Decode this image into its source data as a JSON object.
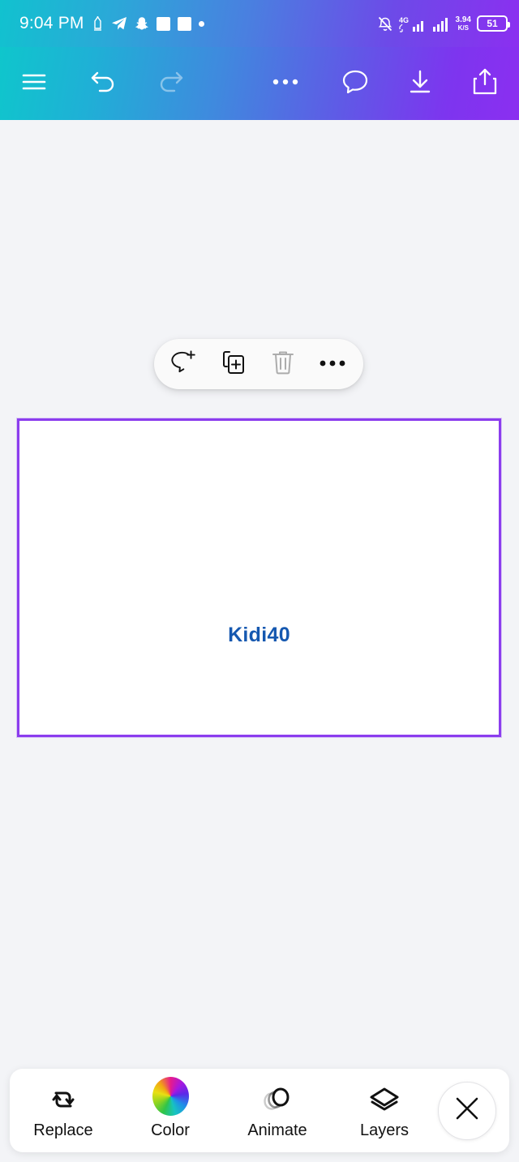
{
  "colors": {
    "gradient_start": "#0fc6cc",
    "gradient_end": "#8b2ff0",
    "selection_border": "#8b3dee",
    "canvas_bg": "#f3f4f7",
    "artboard_text": "#1558b0"
  },
  "statusbar": {
    "time": "9:04 PM",
    "left_icons": [
      "alarm-icon",
      "telegram-icon",
      "snapchat-icon",
      "app-square-icon",
      "app-square-icon-2",
      "dot-icon"
    ],
    "mute_icon": "bell-mute-icon",
    "network_type": "4G",
    "speed_value": "3.94",
    "speed_unit": "K/S",
    "battery_level": "51"
  },
  "toolbar": {
    "menu_label": "Menu",
    "undo_label": "Undo",
    "redo_label": "Redo",
    "redo_disabled": true,
    "more_label": "More",
    "comment_label": "Comment",
    "download_label": "Download",
    "share_label": "Share"
  },
  "context_toolbar": {
    "items": [
      {
        "name": "add-comment",
        "label": "Add comment",
        "disabled": false
      },
      {
        "name": "duplicate",
        "label": "Duplicate",
        "disabled": false
      },
      {
        "name": "delete",
        "label": "Delete",
        "disabled": true
      },
      {
        "name": "more-options",
        "label": "More options",
        "disabled": false
      }
    ]
  },
  "artboard": {
    "text": "Kidi40",
    "selected": true
  },
  "bottom_toolbar": {
    "items": [
      {
        "label": "Replace",
        "icon": "replace-icon"
      },
      {
        "label": "Color",
        "icon": "color-wheel-icon"
      },
      {
        "label": "Animate",
        "icon": "animate-icon"
      },
      {
        "label": "Layers",
        "icon": "layers-icon"
      }
    ],
    "close_label": "Close"
  }
}
